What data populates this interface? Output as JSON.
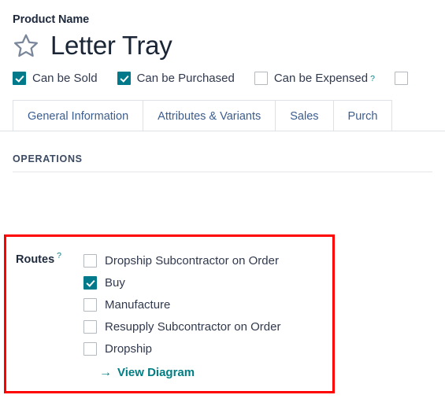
{
  "header": {
    "field_label": "Product Name",
    "product_name": "Letter Tray",
    "favorite_icon": "star-icon",
    "favorite_active": false
  },
  "flags": [
    {
      "label": "Can be Sold",
      "checked": true,
      "help": ""
    },
    {
      "label": "Can be Purchased",
      "checked": true,
      "help": ""
    },
    {
      "label": "Can be Expensed",
      "checked": false,
      "help": "?"
    },
    {
      "label": "",
      "checked": false,
      "help": ""
    }
  ],
  "tabs": [
    {
      "label": "General Information",
      "active": true
    },
    {
      "label": "Attributes & Variants",
      "active": false
    },
    {
      "label": "Sales",
      "active": false
    },
    {
      "label": "Purch",
      "active": false
    }
  ],
  "section": {
    "title": "OPERATIONS"
  },
  "routes": {
    "label": "Routes",
    "help": "?",
    "items": [
      {
        "label": "Dropship Subcontractor on Order",
        "checked": false
      },
      {
        "label": "Buy",
        "checked": true
      },
      {
        "label": "Manufacture",
        "checked": false
      },
      {
        "label": "Resupply Subcontractor on Order",
        "checked": false
      },
      {
        "label": "Dropship",
        "checked": false
      }
    ],
    "view_diagram": {
      "label": "View Diagram",
      "icon": "arrow-right-icon",
      "arrow": "→"
    }
  },
  "colors": {
    "accent_teal": "#00798a",
    "link_teal": "#017e84",
    "highlight_red": "#ff0000",
    "title_dark": "#1a2536",
    "tab_blue": "#3c5d8f"
  }
}
